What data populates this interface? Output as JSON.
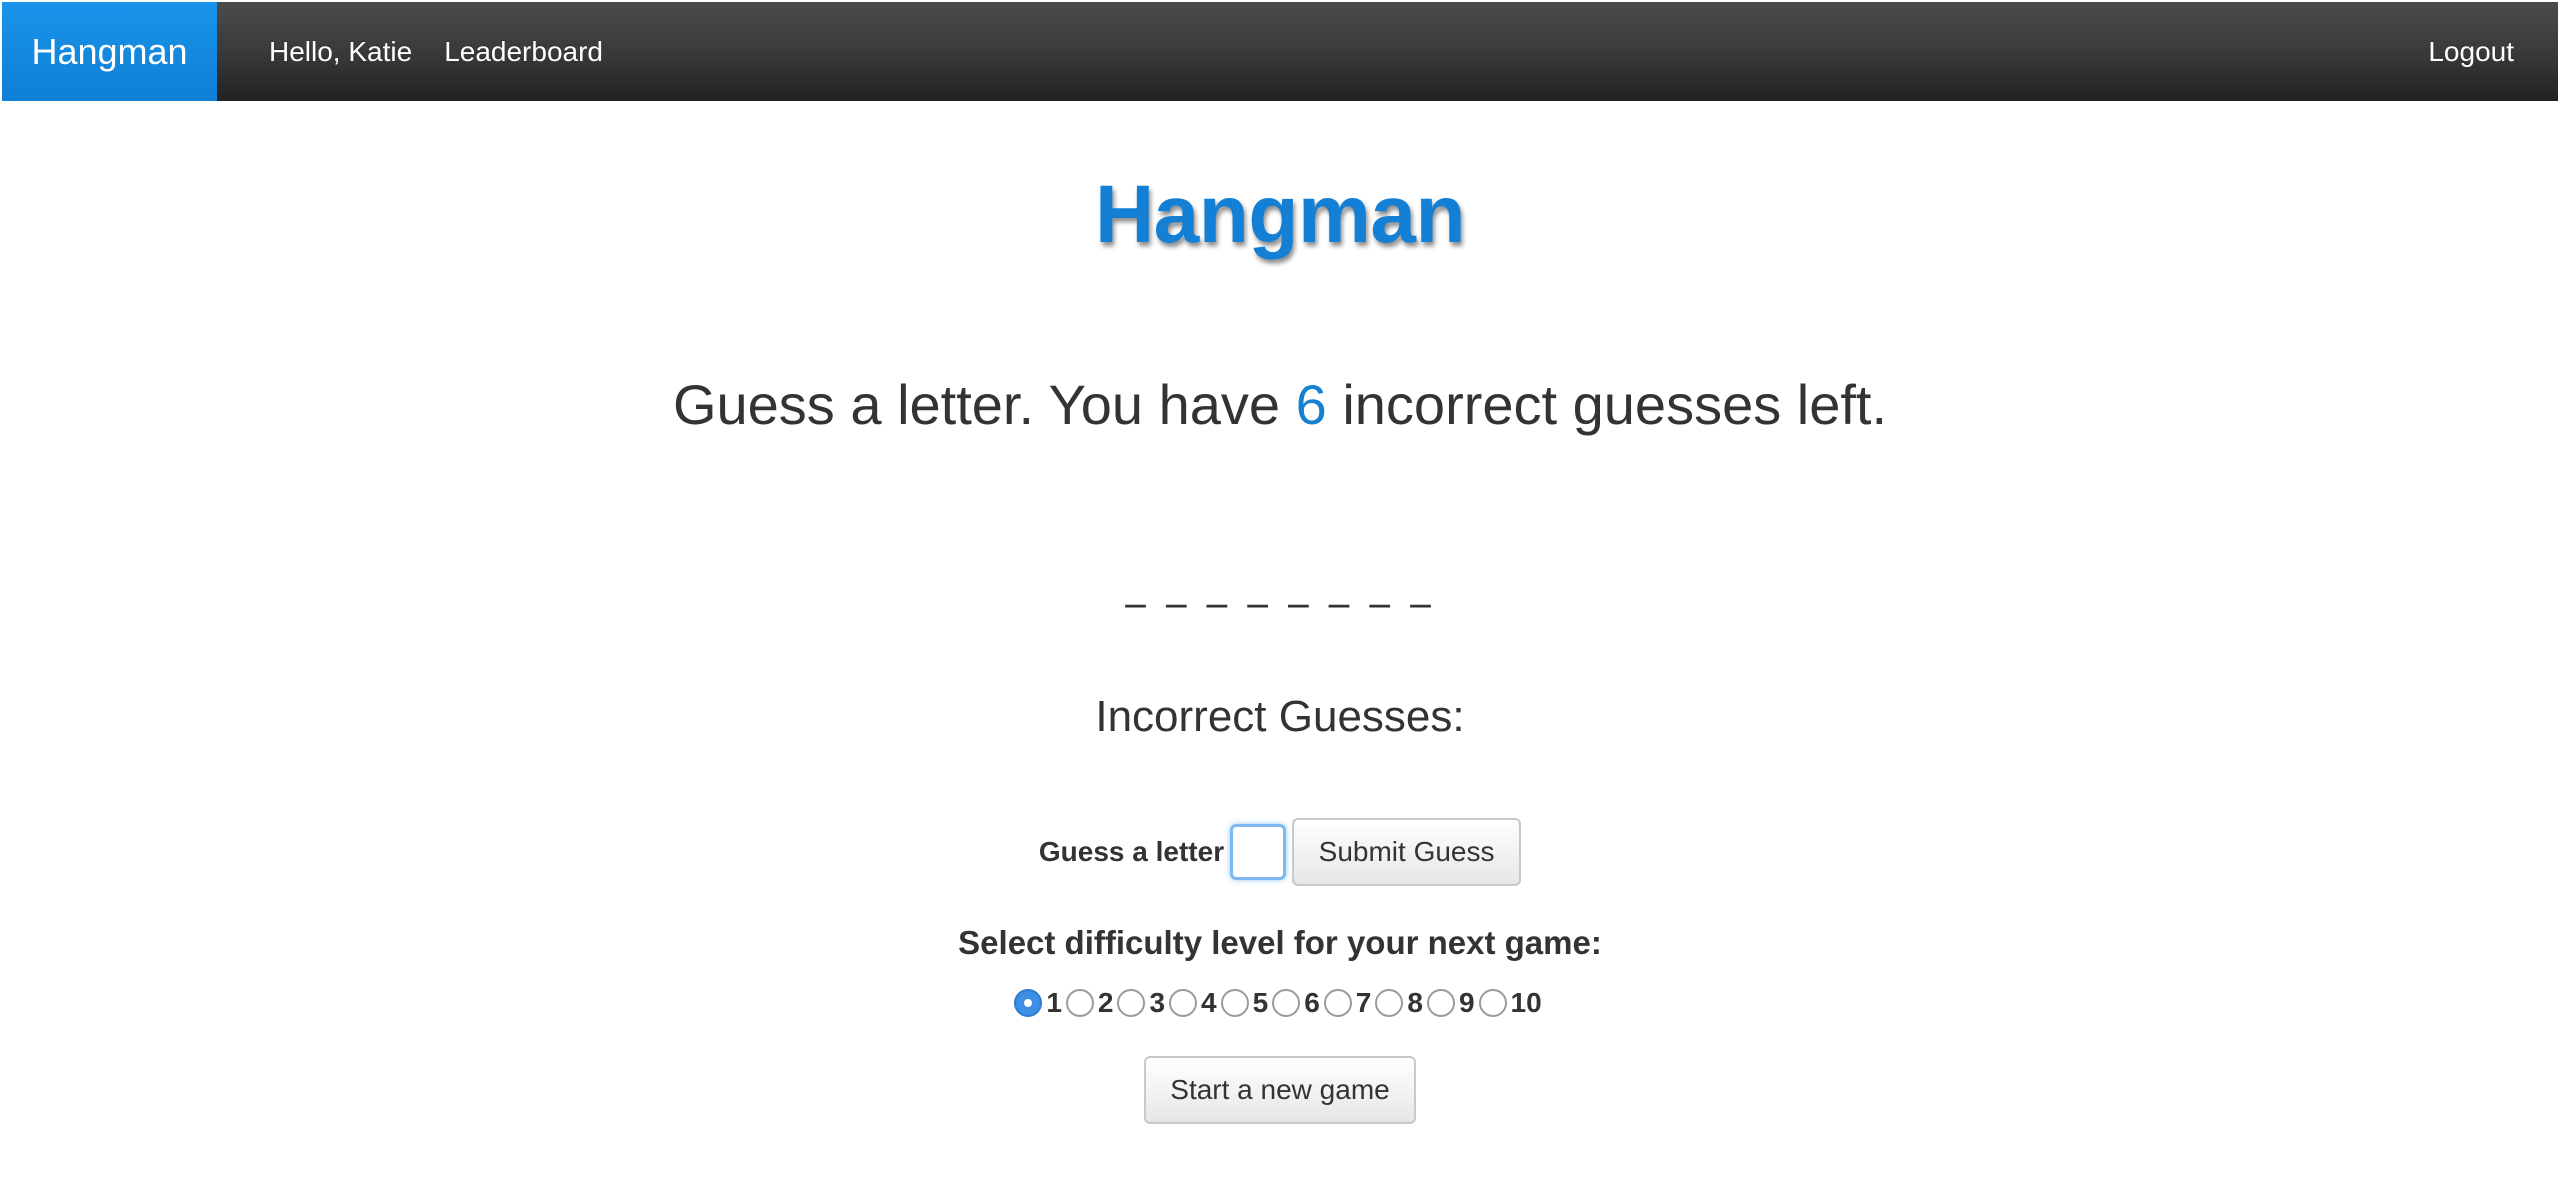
{
  "navbar": {
    "brand": "Hangman",
    "greeting": "Hello, Katie",
    "leaderboard": "Leaderboard",
    "logout": "Logout"
  },
  "main": {
    "title": "Hangman",
    "status_prefix": "Guess a letter. You have ",
    "guesses_left": "6",
    "status_suffix": " incorrect guesses left.",
    "word_display": "_ _ _ _ _ _ _ _",
    "incorrect_label": "Incorrect Guesses:",
    "incorrect_letters": ""
  },
  "guess_form": {
    "label": "Guess a letter",
    "input_value": "",
    "submit_label": "Submit Guess"
  },
  "difficulty": {
    "label": "Select difficulty level for your next game:",
    "options": [
      "1",
      "2",
      "3",
      "4",
      "5",
      "6",
      "7",
      "8",
      "9",
      "10"
    ],
    "selected": "1"
  },
  "new_game_label": "Start a new game",
  "colors": {
    "brand_blue": "#1380d6",
    "navbar_dark": "#333333",
    "radio_selected": "#3d8fe6"
  }
}
